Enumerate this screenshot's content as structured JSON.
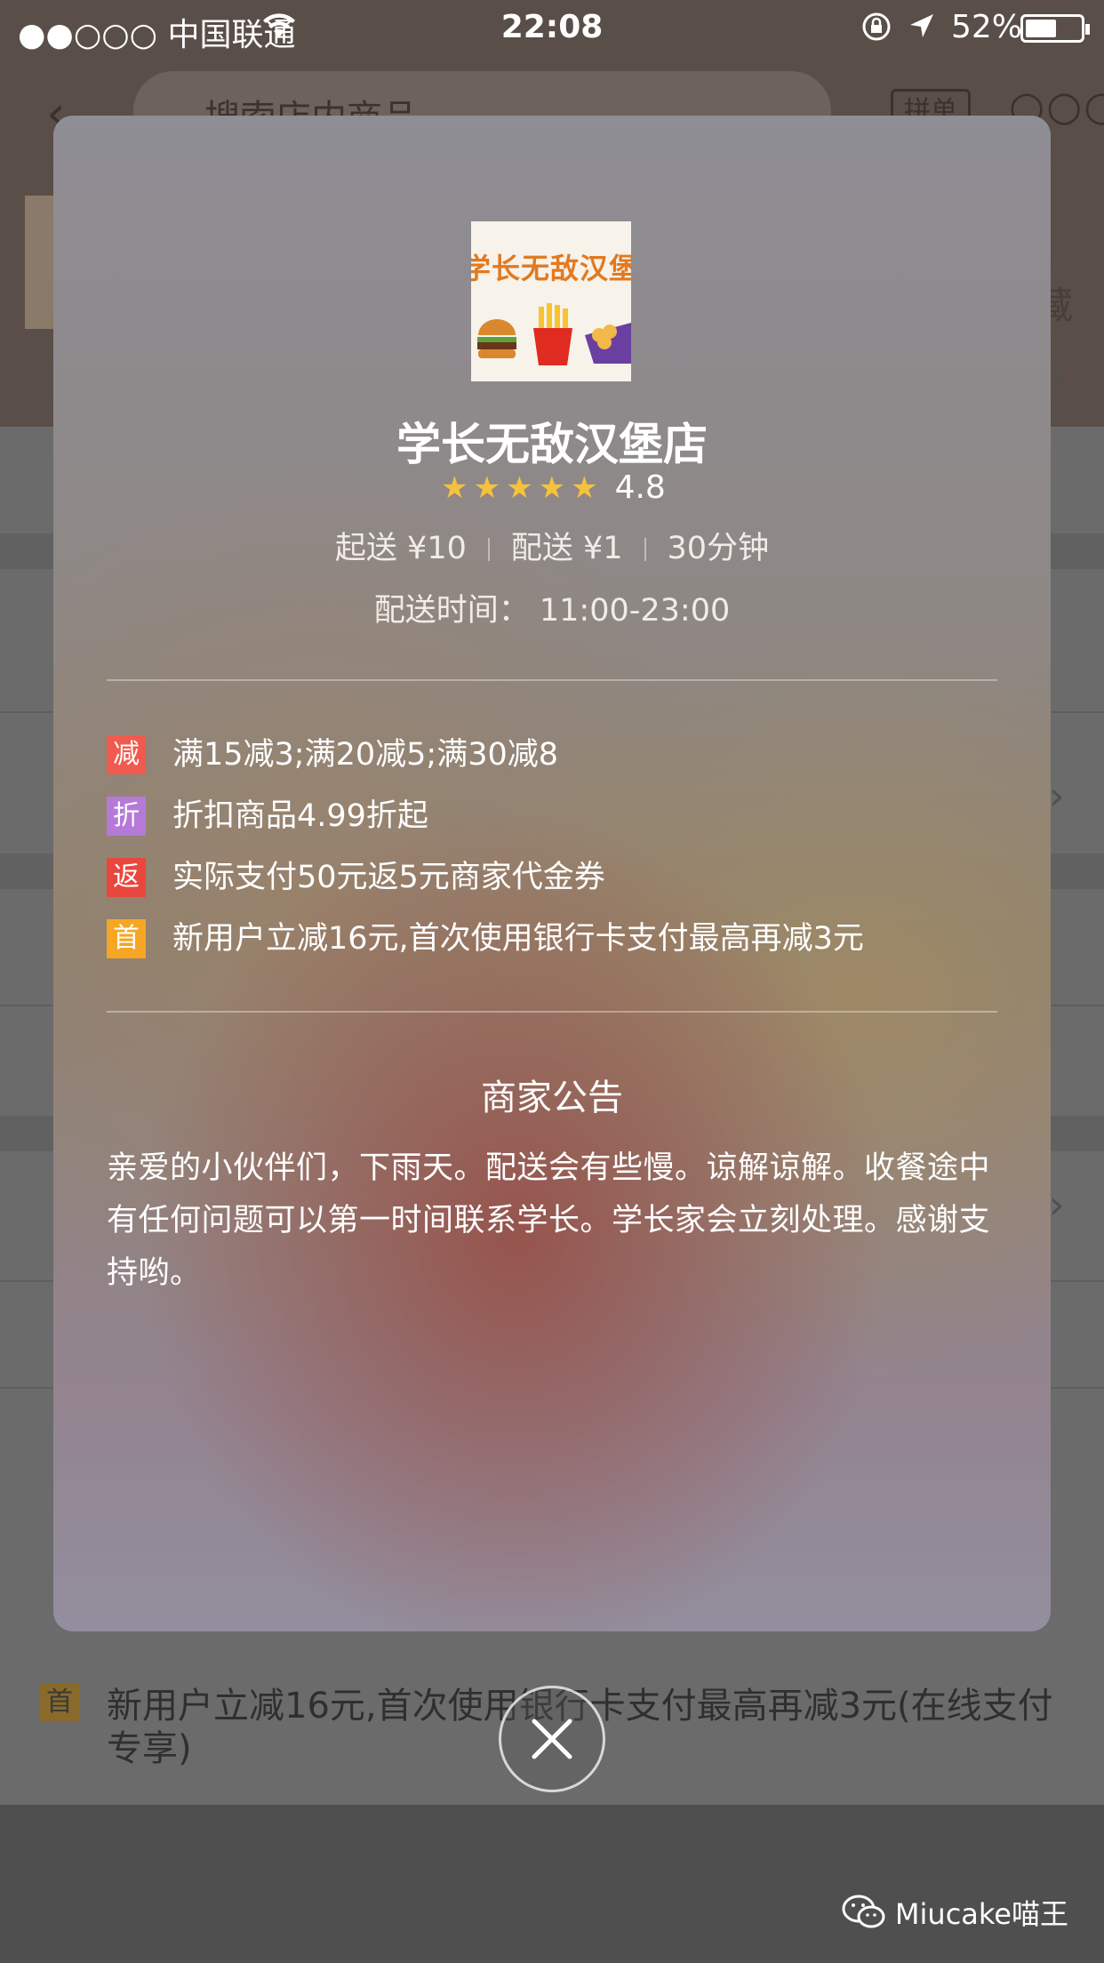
{
  "status_bar": {
    "carrier": "●●○○○ 中国联通",
    "time": "22:08",
    "battery_pct": "52%",
    "battery_level": 0.52,
    "icons": [
      "wifi-icon",
      "orientation-lock-icon",
      "location-arrow-icon",
      "battery-icon"
    ]
  },
  "background": {
    "search_placeholder": "搜索店内商品",
    "pin_label": "拼单",
    "fav_label": "藏",
    "promo_text": "新用户立减16元,首次使用银行卡支付最高再减3元(在线支付专享)",
    "promo_tag": "首"
  },
  "shop": {
    "logo_text": "学长无敌汉堡",
    "name": "学长无敌汉堡店",
    "rating": "4.8",
    "stars": 5,
    "min_order": "起送 ¥10",
    "delivery_fee": "配送 ¥1",
    "delivery_time": "30分钟",
    "hours": "配送时间：  11:00-23:00"
  },
  "promotions": [
    {
      "tag": "减",
      "color": "#f05a4f",
      "text": "满15减3;满20减5;满30减8"
    },
    {
      "tag": "折",
      "color": "#b57ad8",
      "text": "折扣商品4.99折起"
    },
    {
      "tag": "返",
      "color": "#e8473e",
      "text": "实际支付50元返5元商家代金券"
    },
    {
      "tag": "首",
      "color": "#f6a623",
      "text": "新用户立减16元,首次使用银行卡支付最高再减3元"
    }
  ],
  "notice": {
    "title": "商家公告",
    "body": "亲爱的小伙伴们，下雨天。配送会有些慢。谅解谅解。收餐途中有任何问题可以第一时间联系学长。学长家会立刻处理。感谢支持哟。"
  },
  "watermark": "Miucake喵王",
  "colors": {
    "star": "#f6c23c",
    "logo_text": "#e17a22"
  }
}
